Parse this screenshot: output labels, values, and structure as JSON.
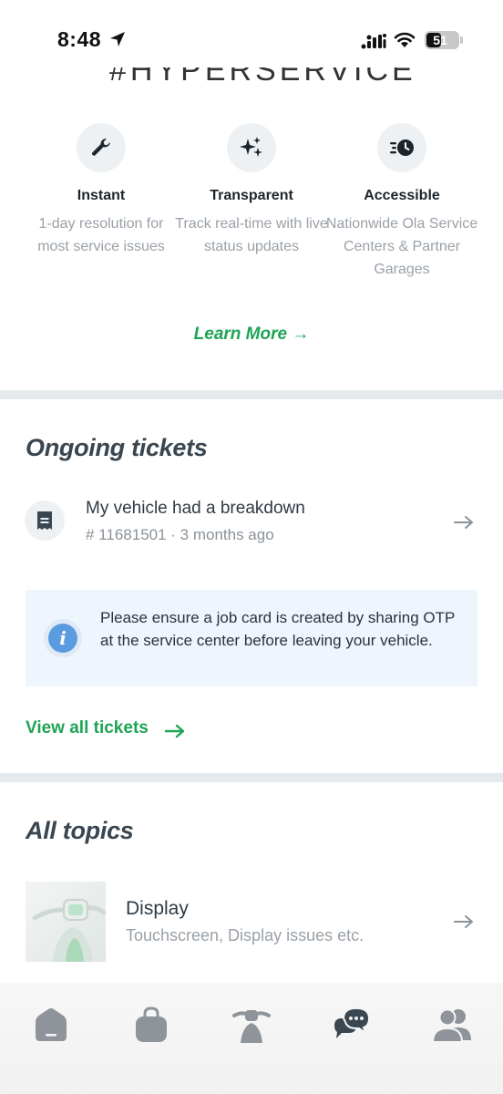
{
  "status_bar": {
    "time": "8:48",
    "battery": "51"
  },
  "header": {
    "title_cut": "#HYPERSERVICE"
  },
  "features": [
    {
      "icon": "wrench-icon",
      "title": "Instant",
      "description": "1-day resolution for most service issues"
    },
    {
      "icon": "sparkles-icon",
      "title": "Transparent",
      "description": "Track real-time with live status updates"
    },
    {
      "icon": "fast-clock-icon",
      "title": "Accessible",
      "description": "Nationwide Ola Service Centers & Partner Garages"
    }
  ],
  "learn_more": "Learn More →",
  "ongoing": {
    "title": "Ongoing tickets",
    "ticket": {
      "icon": "receipt-icon",
      "title": "My vehicle had a breakdown",
      "meta": "# 11681501 · 3 months ago"
    },
    "info": "Please ensure a job card is created by sharing OTP at the service center before leaving your vehicle.",
    "view_all": "View all tickets"
  },
  "topics": {
    "title": "All topics",
    "items": [
      {
        "title": "Display",
        "description": "Touchscreen, Display issues etc."
      }
    ]
  },
  "bottom_nav": [
    {
      "icon": "home-icon"
    },
    {
      "icon": "shopping-bag-icon"
    },
    {
      "icon": "scooter-icon"
    },
    {
      "icon": "chat-support-icon"
    },
    {
      "icon": "community-icon"
    }
  ],
  "colors": {
    "accent": "#1ea455",
    "text": "#2f3a44",
    "muted": "#9aa1a8",
    "info_bg": "#eef5fc",
    "divider": "#e4e9ed"
  }
}
